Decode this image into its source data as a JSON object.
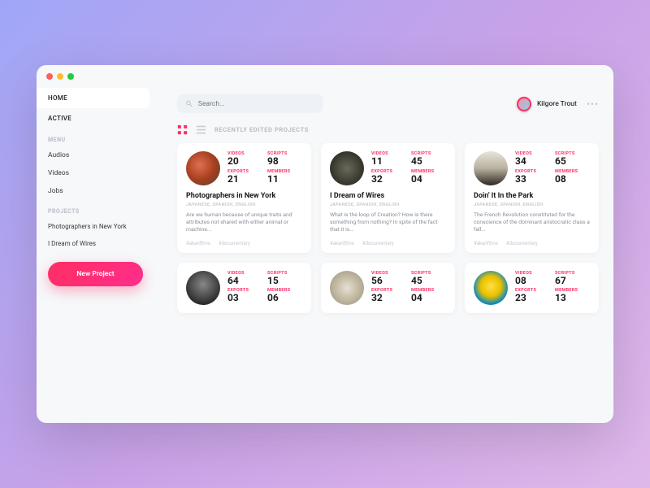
{
  "nav": {
    "home": "HOME",
    "active": "ACTIVE"
  },
  "sidebar": {
    "menu_label": "MENU",
    "menu": [
      "Audios",
      "Videos",
      "Jobs"
    ],
    "projects_label": "PROJECTS",
    "projects": [
      "Photographers in New York",
      "I Dream of Wires"
    ],
    "new_project": "New Project"
  },
  "search": {
    "placeholder": "Search..."
  },
  "user": {
    "name": "Kilgore Trout"
  },
  "section": {
    "title": "RECENTLY EDITED PROJECTS"
  },
  "stat_labels": {
    "videos": "VIDEOS",
    "scripts": "SCRIPTS",
    "exports": "EXPORTS",
    "members": "MEMBERS"
  },
  "langs": "JAPANESE, SPANISH, ENGLISH",
  "tags": [
    "#akarifilms",
    "#documentary"
  ],
  "cards": [
    {
      "title": "Photographers in New York",
      "desc": "Are we human because of unique traits and attributes not shared with either animal or machine...",
      "videos": "20",
      "scripts": "98",
      "exports": "21",
      "members": "11"
    },
    {
      "title": "I Dream of Wires",
      "desc": "What is the loop of Creation? How is there something from nothing? In spite of the fact that it is...",
      "videos": "11",
      "scripts": "45",
      "exports": "32",
      "members": "04"
    },
    {
      "title": "Doin' It In the Park",
      "desc": "The French Revolution constituted for the conscience of the dominant aristocratic class a fall...",
      "videos": "34",
      "scripts": "65",
      "exports": "33",
      "members": "08"
    },
    {
      "title": "",
      "desc": "",
      "videos": "64",
      "scripts": "15",
      "exports": "03",
      "members": "06"
    },
    {
      "title": "",
      "desc": "",
      "videos": "56",
      "scripts": "45",
      "exports": "32",
      "members": "04"
    },
    {
      "title": "",
      "desc": "",
      "videos": "08",
      "scripts": "67",
      "exports": "23",
      "members": "13"
    }
  ]
}
